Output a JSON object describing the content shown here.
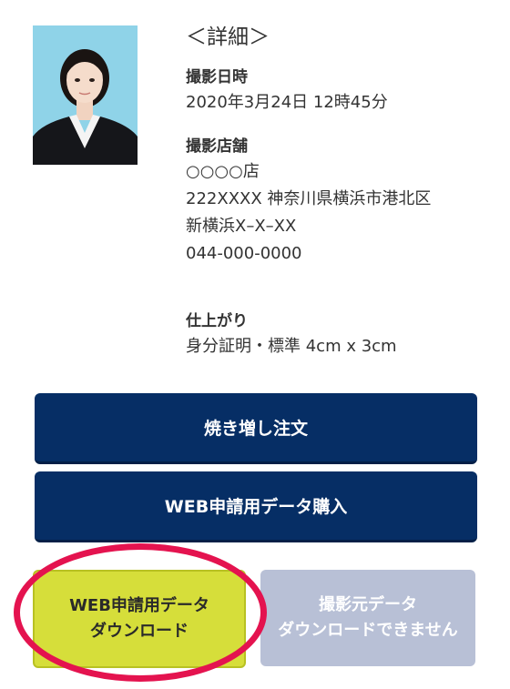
{
  "details": {
    "title": "＜詳細＞",
    "shoot_label": "撮影日時",
    "shoot_value": "2020年3月24日 12時45分",
    "store_label": "撮影店舗",
    "store_lines": [
      "○○○○店",
      "222XXXX 神奈川県横浜市港北区",
      "新横浜X–X–XX",
      "044-000-0000"
    ],
    "finish_label": "仕上がり",
    "finish_value": "身分証明・標準 4cm x 3cm"
  },
  "buttons": {
    "reprint": "焼き増し注文",
    "web_purchase": "WEB申請用データ購入",
    "web_download_lines": [
      "WEB申請用データ",
      "ダウンロード"
    ],
    "original_lines": [
      "撮影元データ",
      "ダウンロードできません"
    ]
  },
  "colors": {
    "navy": "#062e65",
    "lime": "#d6de3a",
    "disabled": "#b8c0d6",
    "highlight": "#e4134f",
    "photo_bg": "#8fd3e8"
  }
}
